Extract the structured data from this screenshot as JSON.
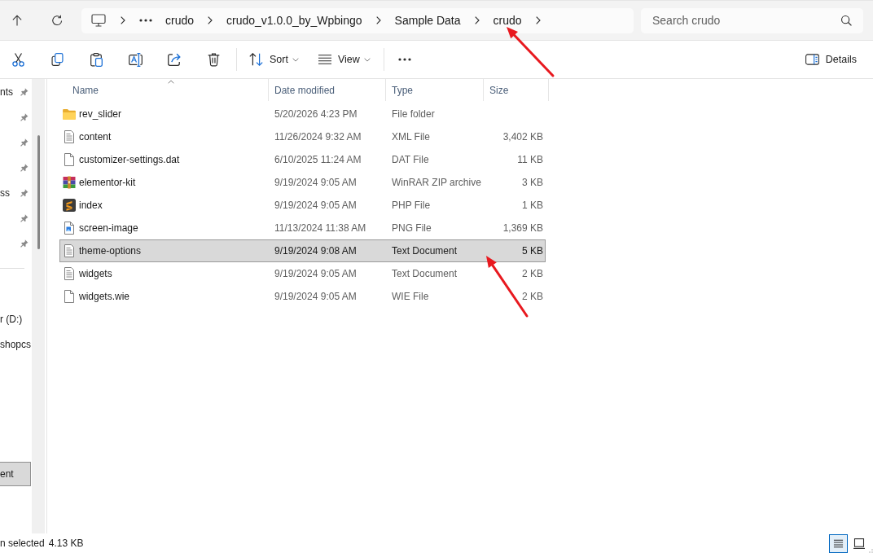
{
  "address_bar": {
    "breadcrumbs": [
      "crudo",
      "crudo_v1.0.0_by_Wpbingo",
      "Sample Data",
      "crudo"
    ]
  },
  "search": {
    "placeholder": "Search crudo"
  },
  "toolbar": {
    "items": [
      {
        "kind": "cut"
      },
      {
        "kind": "copy"
      },
      {
        "kind": "paste"
      },
      {
        "kind": "rename"
      },
      {
        "kind": "share"
      },
      {
        "kind": "delete"
      },
      {
        "kind": "separator"
      },
      {
        "kind": "sort",
        "label": "Sort"
      },
      {
        "kind": "view",
        "label": "View"
      },
      {
        "kind": "separator"
      },
      {
        "kind": "more"
      }
    ],
    "details": {
      "label": "Details"
    }
  },
  "navigation_pane": {
    "sections": [
      {
        "items": [
          {
            "label": "nts",
            "pinned": true,
            "selected": false
          },
          {
            "pinned": true,
            "selected": false
          },
          {
            "pinned": true,
            "selected": false
          },
          {
            "pinned": true,
            "selected": false
          },
          {
            "label": "ss",
            "pinned": true,
            "selected": false
          },
          {
            "pinned": true,
            "selected": false
          },
          {
            "pinned": true,
            "selected": false
          }
        ]
      },
      {
        "items": [
          {
            "label": "r (D:)",
            "pinned": false,
            "selected": false
          },
          {
            "label": "shopcs",
            "pinned": false,
            "selected": false
          }
        ]
      },
      {
        "items": [
          {
            "label": "ent",
            "pinned": false,
            "selected": true
          }
        ]
      }
    ]
  },
  "file_list": {
    "columns": [
      {
        "label": "Name",
        "sorted": true
      },
      {
        "label": "Date modified",
        "sorted": false
      },
      {
        "label": "Type",
        "sorted": false
      },
      {
        "label": "Size",
        "sorted": false
      }
    ],
    "rows": [
      {
        "kind": "folder",
        "name": "rev_slider",
        "date_modified": "5/20/2026 4:23 PM",
        "type": "File folder",
        "selected": false
      },
      {
        "kind": "text",
        "name": "content",
        "date_modified": "11/26/2024 9:32 AM",
        "type": "XML File",
        "size": "3,402 KB",
        "selected": false
      },
      {
        "kind": "file",
        "name": "customizer-settings.dat",
        "date_modified": "6/10/2025 11:24 AM",
        "type": "DAT File",
        "size": "11 KB",
        "selected": false
      },
      {
        "kind": "archive",
        "name": "elementor-kit",
        "date_modified": "9/19/2024 9:05 AM",
        "type": "WinRAR ZIP archive",
        "size": "3 KB",
        "selected": false
      },
      {
        "kind": "script",
        "name": "index",
        "date_modified": "9/19/2024 9:05 AM",
        "type": "PHP File",
        "size": "1 KB",
        "selected": false
      },
      {
        "kind": "image",
        "name": "screen-image",
        "date_modified": "11/13/2024 11:38 AM",
        "type": "PNG File",
        "size": "1,369 KB",
        "selected": false
      },
      {
        "kind": "text",
        "name": "theme-options",
        "date_modified": "9/19/2024 9:08 AM",
        "type": "Text Document",
        "size": "5 KB",
        "selected": true
      },
      {
        "kind": "text",
        "name": "widgets",
        "date_modified": "9/19/2024 9:05 AM",
        "type": "Text Document",
        "size": "2 KB",
        "selected": false
      },
      {
        "kind": "file",
        "name": "widgets.wie",
        "date_modified": "9/19/2024 9:05 AM",
        "type": "WIE File",
        "size": "2 KB",
        "selected": false
      }
    ]
  },
  "status_bar": {
    "selection": "n selected",
    "size": "4.13 KB",
    "view_buttons": [
      {
        "kind": "details",
        "selected": true
      },
      {
        "kind": "thumbnails",
        "selected": false
      }
    ]
  }
}
